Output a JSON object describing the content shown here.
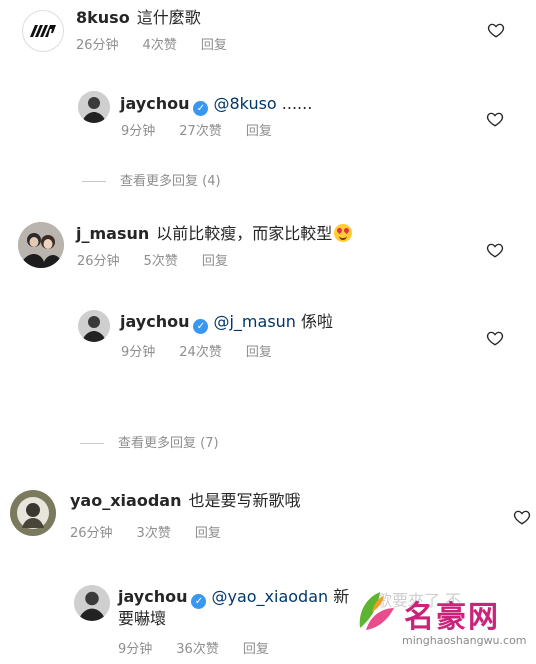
{
  "comments": [
    {
      "username": "8kuso",
      "text": "這什麼歌",
      "time": "26分钟",
      "likes": "4次赞",
      "reply": "回复"
    },
    {
      "username": "jaychou",
      "mention": "@8kuso",
      "text": " ......",
      "time": "9分钟",
      "likes": "27次赞",
      "reply": "回复"
    },
    {
      "username": "j_masun",
      "text": "以前比較瘦，而家比較型",
      "time": "26分钟",
      "likes": "5次赞",
      "reply": "回复"
    },
    {
      "username": "jaychou",
      "mention": "@j_masun",
      "text": " 係啦",
      "time": "9分钟",
      "likes": "24次赞",
      "reply": "回复"
    },
    {
      "username": "yao_xiaodan",
      "text": "也是要写新歌哦",
      "time": "26分钟",
      "likes": "3次赞",
      "reply": "回复"
    },
    {
      "username": "jaychou",
      "mention": "@yao_xiaodan",
      "text": " 新",
      "text_line2": "要嚇壞",
      "time": "9分钟",
      "likes": "36次赞",
      "reply": "回复"
    }
  ],
  "view_more": [
    "查看更多回复 (4)",
    "查看更多回复 (7)"
  ],
  "watermark": {
    "brand": "名豪网",
    "url": "minghaoshangwu.com",
    "obscured_text": "歌要來了 不"
  },
  "colors": {
    "verified": "#3897f0",
    "mention": "#00376b",
    "meta": "#8e8e8e",
    "watermark": "#c9237a"
  }
}
